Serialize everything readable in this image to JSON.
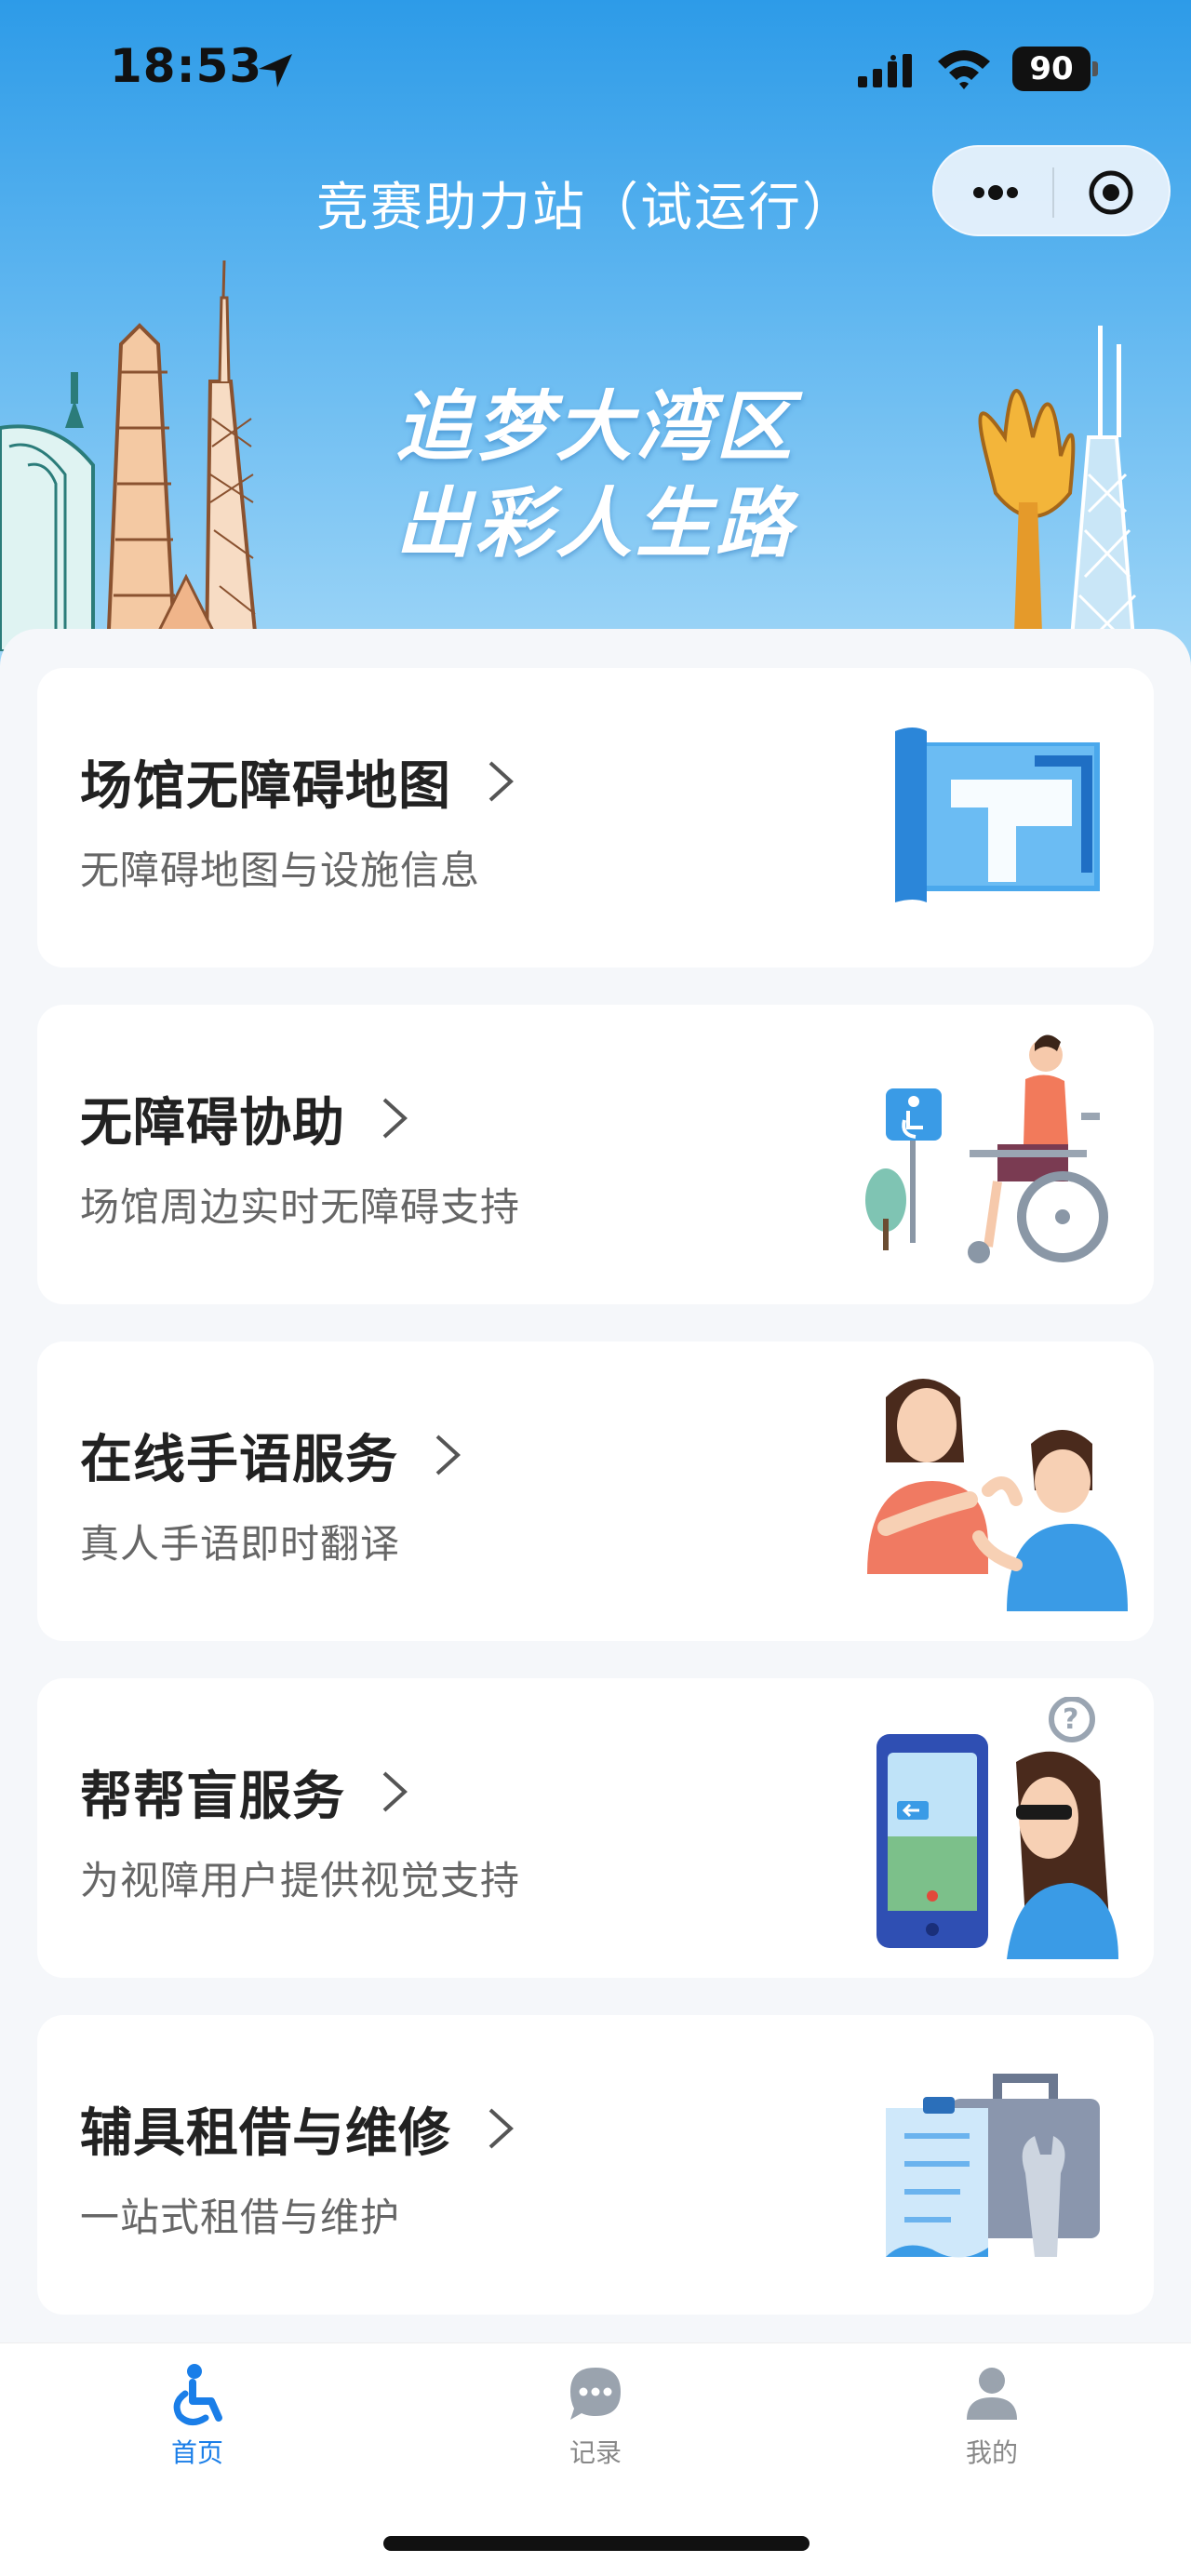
{
  "status_bar": {
    "time": "18:53",
    "battery": "90"
  },
  "nav": {
    "title": "竞赛助力站（试运行）"
  },
  "banner": {
    "slogan_line1": "追梦大湾区",
    "slogan_line2": "出彩人生路"
  },
  "cards": [
    {
      "title": "场馆无障碍地图",
      "subtitle": "无障碍地图与设施信息",
      "icon": "map-illustration"
    },
    {
      "title": "无障碍协助",
      "subtitle": "场馆周边实时无障碍支持",
      "icon": "wheelchair-illustration"
    },
    {
      "title": "在线手语服务",
      "subtitle": "真人手语即时翻译",
      "icon": "sign-language-illustration"
    },
    {
      "title": "帮帮盲服务",
      "subtitle": "为视障用户提供视觉支持",
      "icon": "visual-aid-illustration"
    },
    {
      "title": "辅具租借与维修",
      "subtitle": "一站式租借与维护",
      "icon": "toolbox-illustration"
    }
  ],
  "tabbar": {
    "home": "首页",
    "records": "记录",
    "mine": "我的",
    "active": "home"
  },
  "colors": {
    "accent": "#1a7ee8",
    "header_top": "#2d9be8",
    "inactive": "#888888"
  }
}
